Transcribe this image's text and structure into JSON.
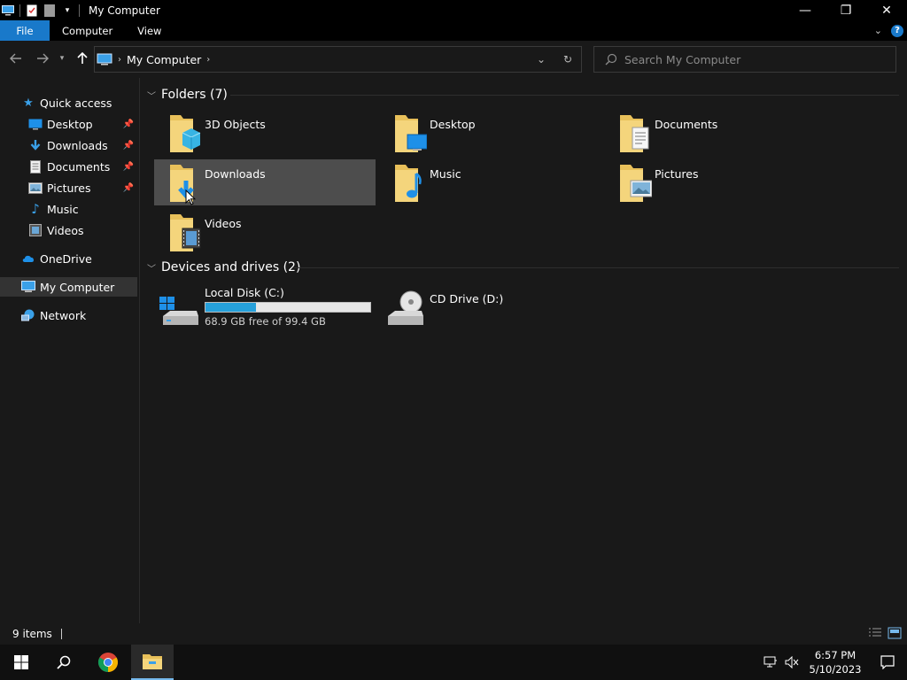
{
  "window": {
    "title": "My Computer",
    "controls": {
      "minimize": "—",
      "restore": "❐",
      "close": "✕"
    }
  },
  "ribbon": {
    "tabs": [
      {
        "label": "File"
      },
      {
        "label": "Computer"
      },
      {
        "label": "View"
      }
    ],
    "help": "?"
  },
  "address": {
    "path": "My Computer",
    "search_placeholder": "Search My Computer"
  },
  "nav_pane": {
    "quick_access": "Quick access",
    "items": [
      {
        "label": "Desktop",
        "pinned": true
      },
      {
        "label": "Downloads",
        "pinned": true
      },
      {
        "label": "Documents",
        "pinned": true
      },
      {
        "label": "Pictures",
        "pinned": true
      },
      {
        "label": "Music",
        "pinned": false
      },
      {
        "label": "Videos",
        "pinned": false
      }
    ],
    "onedrive": "OneDrive",
    "my_computer": "My Computer",
    "network": "Network"
  },
  "content": {
    "folders_header": "Folders (7)",
    "folders": [
      {
        "label": "3D Objects"
      },
      {
        "label": "Desktop"
      },
      {
        "label": "Documents"
      },
      {
        "label": "Downloads"
      },
      {
        "label": "Music"
      },
      {
        "label": "Pictures"
      },
      {
        "label": "Videos"
      }
    ],
    "drives_header": "Devices and drives (2)",
    "drives": [
      {
        "label": "Local Disk (C:)",
        "free_text": "68.9 GB free of 99.4 GB",
        "used_fraction": 0.307
      },
      {
        "label": "CD Drive (D:)"
      }
    ]
  },
  "status": {
    "items_count": "9 items"
  },
  "taskbar": {
    "time": "6:57 PM",
    "date": "5/10/2023"
  },
  "colors": {
    "accent": "#1979ca",
    "drive_fill": "#26a0da",
    "folder": "#e8c05a"
  }
}
